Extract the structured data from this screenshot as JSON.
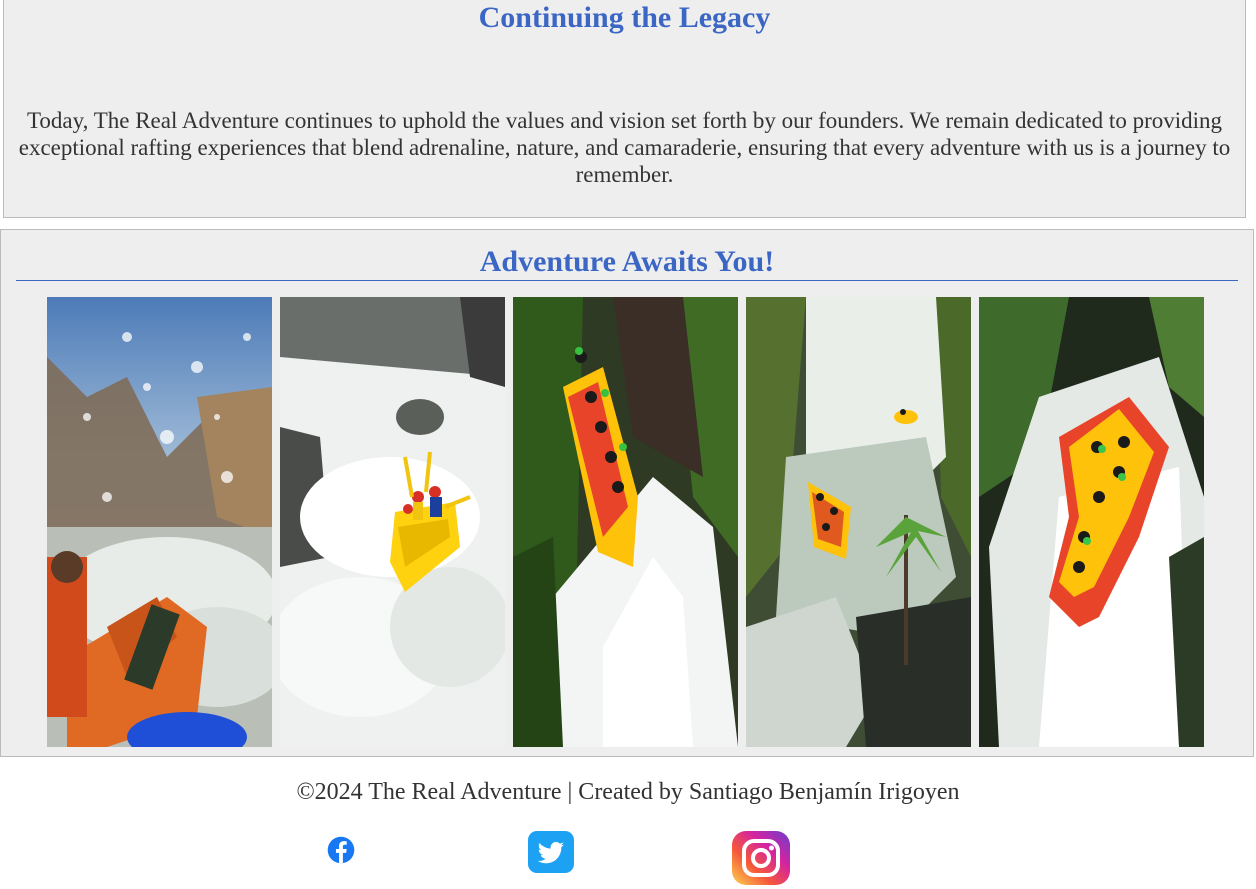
{
  "legacy": {
    "title": "Continuing the Legacy",
    "text": "Today, The Real Adventure continues to uphold the values and vision set forth by our founders. We remain dedicated to providing exceptional rafting experiences that blend adrenaline, nature, and camaraderie, ensuring that every adventure with us is a journey to remember."
  },
  "gallery": {
    "title": "Adventure Awaits You!",
    "photos": [
      {
        "name": "rafting-photo-splash"
      },
      {
        "name": "rafting-photo-rapids"
      },
      {
        "name": "rafting-photo-waterfall-drop"
      },
      {
        "name": "rafting-photo-waterfall-aerial"
      },
      {
        "name": "rafting-photo-waterfall-plunge"
      }
    ]
  },
  "footer": {
    "credit": "©2024 The Real Adventure | Created by Santiago Benjamín Irigoyen",
    "social": [
      {
        "icon": "facebook-icon",
        "color": "#1877f2"
      },
      {
        "icon": "twitter-icon",
        "color": "#1da1f2"
      },
      {
        "icon": "instagram-icon",
        "color": "#d6249f"
      }
    ]
  }
}
